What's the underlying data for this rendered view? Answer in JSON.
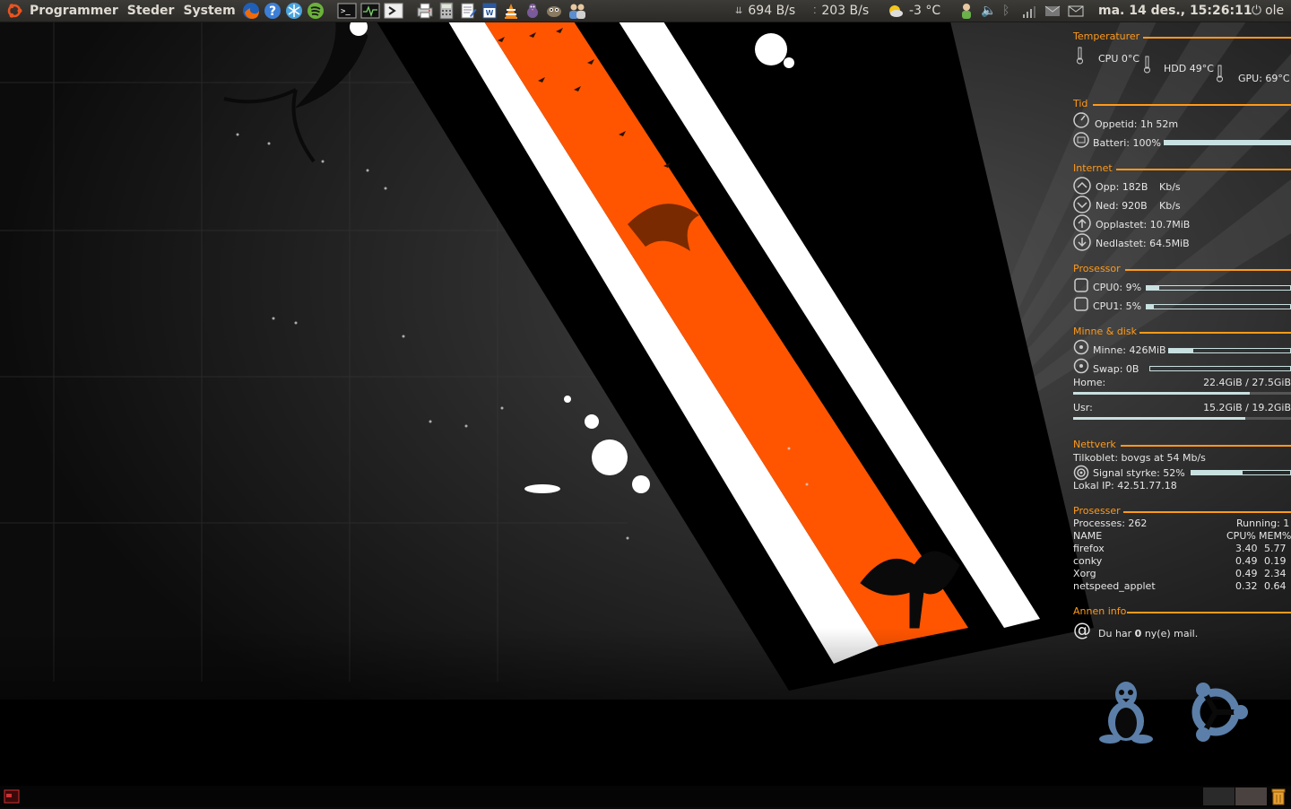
{
  "top_panel": {
    "menus": [
      "Programmer",
      "Steder",
      "System"
    ],
    "net_down": "694 B/s",
    "net_up": "203 B/s",
    "weather": "-3 °C",
    "datetime": "ma. 14 des., 15:26:11",
    "user": "ole"
  },
  "conky": {
    "temperature": {
      "header": "Temperaturer",
      "cpu": "CPU 0°C",
      "hdd": "HDD 49°C",
      "gpu": "GPU: 69°C"
    },
    "time": {
      "header": "Tid",
      "uptime": "Oppetid: 1h 52m",
      "battery": "Batteri: 100%",
      "battery_level": 1.0
    },
    "internet": {
      "header": "Internet",
      "up": "Opp: 182B",
      "up_unit": "Kb/s",
      "down": "Ned: 920B",
      "down_unit": "Kb/s",
      "uploaded": "Opplastet: 10.7MiB",
      "downloaded": "Nedlastet: 64.5MiB"
    },
    "processor": {
      "header": "Prosessor",
      "cpu0": "CPU0: 9%",
      "cpu0_level": 0.09,
      "cpu1": "CPU1: 5%",
      "cpu1_level": 0.05
    },
    "memory": {
      "header": "Minne & disk",
      "mem": "Minne: 426MiB",
      "mem_level": 0.2,
      "swap": "Swap: 0B",
      "swap_level": 0.0,
      "home_label": "Home:",
      "home_value": "22.4GiB / 27.5GiB",
      "home_level": 0.81,
      "usr_label": "Usr:",
      "usr_value": "15.2GiB / 19.2GiB",
      "usr_level": 0.79
    },
    "network": {
      "header": "Nettverk",
      "connected": "Tilkoblet: bovgs at 54 Mb/s",
      "signal": "Signal styrke: 52%",
      "signal_level": 0.52,
      "local_ip": "Lokal IP: 42.51.77.18"
    },
    "processes": {
      "header": "Prosesser",
      "count": "Processes: 262",
      "running": "Running: 1",
      "col_name": "NAME",
      "col_cpu": "CPU%",
      "col_mem": "MEM%",
      "rows": [
        {
          "name": "firefox",
          "cpu": "3.40",
          "mem": "5.77"
        },
        {
          "name": "conky",
          "cpu": "0.49",
          "mem": "0.19"
        },
        {
          "name": "Xorg",
          "cpu": "0.49",
          "mem": "2.34"
        },
        {
          "name": "netspeed_applet",
          "cpu": "0.32",
          "mem": "0.64"
        }
      ]
    },
    "other": {
      "header": "Annen info",
      "mail_prefix": "Du har ",
      "mail_count": "0",
      "mail_suffix": " ny(e) mail."
    }
  },
  "colors": {
    "accent": "#ff9a1a",
    "stripe": "#ff5500",
    "bar": "#c9e0e0",
    "logo": "#5b7fa8"
  },
  "icons": [
    "ubuntu-logo-icon",
    "firefox-icon",
    "help-icon",
    "snowflake-icon",
    "spotify-icon",
    "terminal-icon",
    "system-monitor-icon",
    "run-icon",
    "printer-icon",
    "calculator-icon",
    "text-editor-icon",
    "writer-icon",
    "vlc-icon",
    "pidgin-icon",
    "gimp-icon",
    "users-icon",
    "trash-icon",
    "tux-icon"
  ]
}
